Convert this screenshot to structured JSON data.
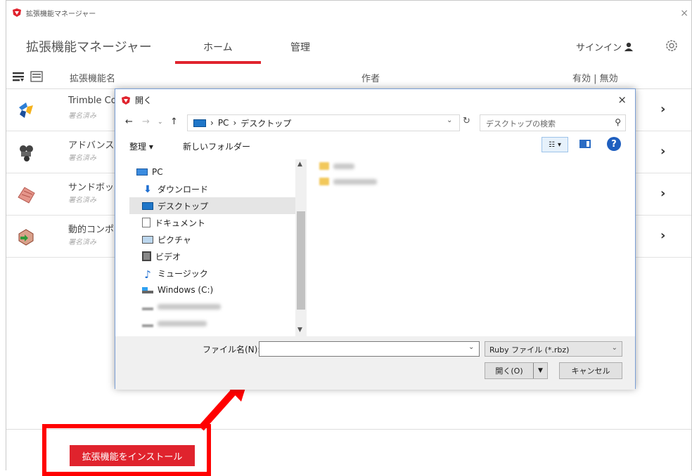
{
  "window": {
    "title": "拡張機能マネージャー",
    "close": "×"
  },
  "nav": {
    "app_title": "拡張機能マネージャー",
    "tabs": [
      "ホーム",
      "管理"
    ],
    "signin": "サインイン"
  },
  "columns": {
    "name": "拡張機能名",
    "author": "作者",
    "status": "有効 | 無効"
  },
  "extensions": [
    {
      "name": "Trimble Co",
      "sub": "署名済み"
    },
    {
      "name": "アドバンス",
      "sub": "署名済み"
    },
    {
      "name": "サンドボッ",
      "sub": "署名済み"
    },
    {
      "name": "動的コンポ",
      "sub": "署名済み"
    }
  ],
  "footer": {
    "install": "拡張機能をインストール"
  },
  "dialog": {
    "title": "開く",
    "close": "×",
    "address": {
      "pc": "PC",
      "sep": "›",
      "folder": "デスクトップ"
    },
    "search_placeholder": "デスクトップの検索",
    "commands": {
      "organize": "整理 ▾",
      "new_folder": "新しいフォルダー"
    },
    "tree": [
      {
        "label": "PC",
        "icon": "pc-icon"
      },
      {
        "label": "ダウンロード",
        "icon": "download-icon"
      },
      {
        "label": "デスクトップ",
        "icon": "desktop-icon",
        "selected": true
      },
      {
        "label": "ドキュメント",
        "icon": "document-icon"
      },
      {
        "label": "ピクチャ",
        "icon": "picture-icon"
      },
      {
        "label": "ビデオ",
        "icon": "video-icon"
      },
      {
        "label": "ミュージック",
        "icon": "music-icon"
      },
      {
        "label": "Windows (C:)",
        "icon": "drive-icon"
      }
    ],
    "filename_label": "ファイル名(N):",
    "filename_value": "",
    "filter": "Ruby ファイル (*.rbz)",
    "open": "開く(O)",
    "cancel": "キャンセル"
  },
  "colors": {
    "accent": "#e0232d",
    "highlight": "#ff0000",
    "selection": "#e5e5e5"
  }
}
